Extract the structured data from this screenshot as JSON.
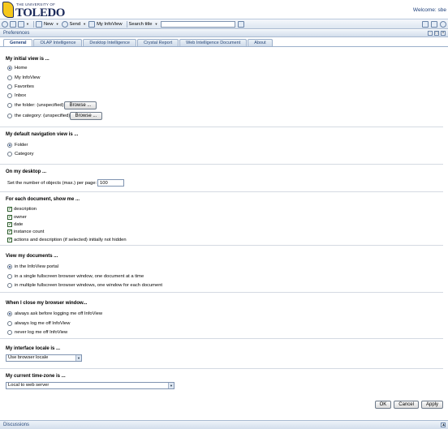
{
  "header": {
    "logo_small": "THE UNIVERSITY OF",
    "logo_big": "TOLEDO",
    "welcome": "Welcome: sbe"
  },
  "toolbar": {
    "new_label": "New",
    "send_label": "Send",
    "myinfoview_label": "My InfoView",
    "search_label": "Search title",
    "search_value": ""
  },
  "pref_bar": {
    "title": "Preferences"
  },
  "tabs": [
    {
      "label": "General"
    },
    {
      "label": "OLAP Intelligence"
    },
    {
      "label": "Desktop Intelligence"
    },
    {
      "label": "Crystal Report"
    },
    {
      "label": "Web Intelligence Document"
    },
    {
      "label": "About"
    }
  ],
  "initial_view": {
    "title": "My initial view is ...",
    "options": [
      {
        "label": "Home",
        "selected": true
      },
      {
        "label": "My InfoView",
        "selected": false
      },
      {
        "label": "Favorites",
        "selected": false
      },
      {
        "label": "Inbox",
        "selected": false
      },
      {
        "label": "the folder: (unspecified)",
        "selected": false
      },
      {
        "label": "the category: (unspecified)",
        "selected": false
      }
    ],
    "browse_label": "Browse ..."
  },
  "nav_view": {
    "title": "My default navigation view is ...",
    "options": [
      {
        "label": "Folder",
        "selected": true
      },
      {
        "label": "Category",
        "selected": false
      }
    ]
  },
  "desktop": {
    "title": "On my desktop ...",
    "objects_label": "Set the number of objects (max.) per page:",
    "objects_value": "100"
  },
  "each_document": {
    "title": "For each document, show me ...",
    "options": [
      {
        "label": "description",
        "checked": true
      },
      {
        "label": "owner",
        "checked": true
      },
      {
        "label": "date",
        "checked": true
      },
      {
        "label": "instance count",
        "checked": true
      },
      {
        "label": "actions and description (if selected) initially not hidden",
        "checked": true
      }
    ]
  },
  "view_docs": {
    "title": "View my documents ...",
    "options": [
      {
        "label": "in the InfoView portal",
        "selected": true
      },
      {
        "label": "in a single fullscreen browser window, one document at a time",
        "selected": false
      },
      {
        "label": "in multiple fullscreen browser windows, one window for each document",
        "selected": false
      }
    ]
  },
  "close_browser": {
    "title": "When I close my browser window...",
    "options": [
      {
        "label": "always ask before logging me off InfoView",
        "selected": true
      },
      {
        "label": "always log me off InfoView",
        "selected": false
      },
      {
        "label": "never log me off InfoView",
        "selected": false
      }
    ]
  },
  "locale": {
    "title": "My interface locale is ...",
    "value": "Use browser locale"
  },
  "timezone": {
    "title": "My current time-zone is ...",
    "value": "Local to web server"
  },
  "buttons": {
    "ok": "OK",
    "cancel": "Cancel",
    "apply": "Apply"
  },
  "disc_bar": {
    "title": "Discussions"
  },
  "icons": {
    "toolbar_left": [
      "refresh-icon",
      "list-view-icon",
      "folder-view-icon",
      "new-document-icon",
      "send-icon",
      "my-infoview-icon"
    ],
    "toolbar_right": [
      "dashboard-icon",
      "lock-icon",
      "preferences-icon"
    ]
  }
}
